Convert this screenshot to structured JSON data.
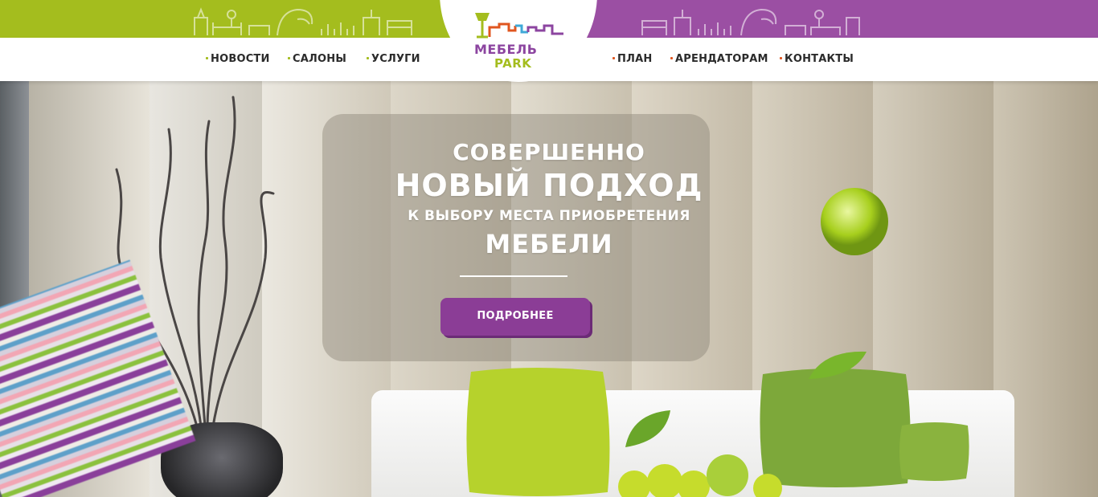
{
  "brand": {
    "name_top": "МЕБЕЛЬ",
    "name_bottom": "PARK",
    "colors": {
      "green": "#a4bd1e",
      "purple": "#9b4fa3",
      "accent_orange": "#e0561f",
      "button": "#8b3d96"
    }
  },
  "nav": {
    "left": [
      {
        "label": "НОВОСТИ"
      },
      {
        "label": "САЛОНЫ"
      },
      {
        "label": "УСЛУГИ"
      }
    ],
    "right": [
      {
        "label": "ПЛАН"
      },
      {
        "label": "АРЕНДАТОРАМ"
      },
      {
        "label": "КОНТАКТЫ"
      }
    ]
  },
  "hero": {
    "line1": "СОВЕРШЕННО",
    "line2": "НОВЫЙ ПОДХОД",
    "line3": "К ВЫБОРУ МЕСТА ПРИОБРЕТЕНИЯ",
    "line4": "МЕБЕЛИ",
    "button_label": "ПОДРОБНЕЕ"
  }
}
